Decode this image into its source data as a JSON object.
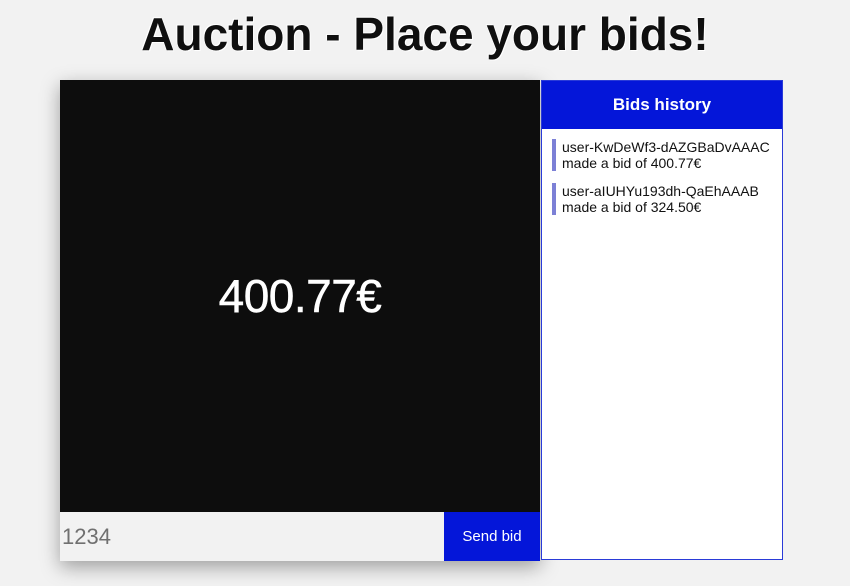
{
  "page": {
    "title": "Auction - Place your bids!"
  },
  "auction": {
    "current_price": "400.77€",
    "bid_input": {
      "value": "",
      "placeholder": "1234"
    },
    "send_label": "Send bid"
  },
  "history": {
    "title": "Bids history",
    "items": [
      {
        "text": "user-KwDeWf3-dAZGBaDvAAAC made a bid of 400.77€"
      },
      {
        "text": "user-aIUHYu193dh-QaEhAAAB made a bid of 324.50€"
      }
    ]
  },
  "colors": {
    "accent": "#0416d9",
    "price_background": "#0d0d0d",
    "history_marker": "#7c80d6"
  }
}
